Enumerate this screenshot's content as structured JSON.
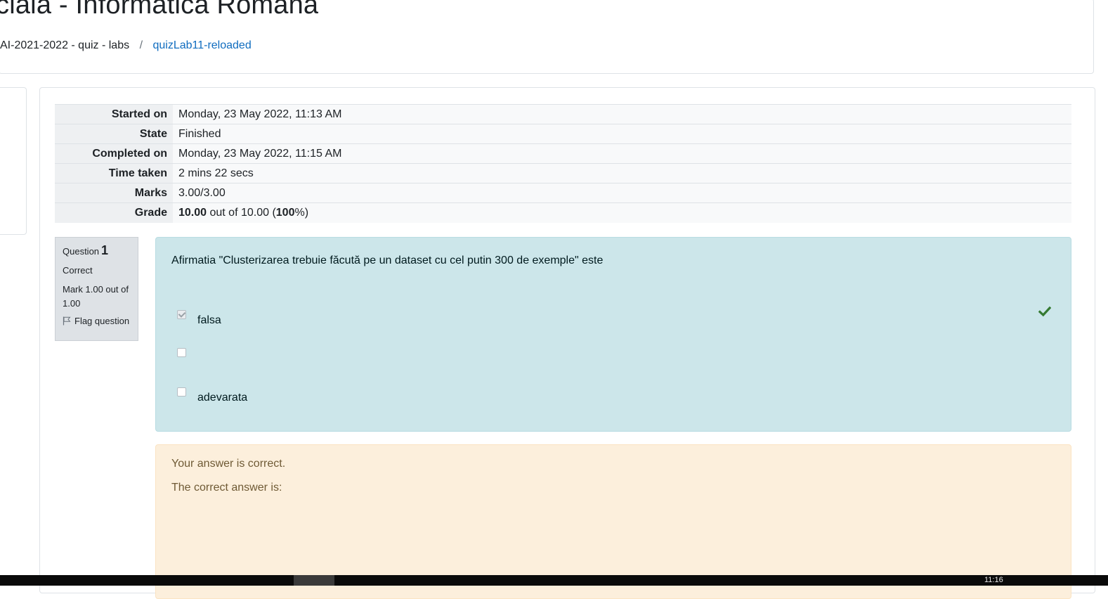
{
  "page": {
    "title": "ciala - Informatica Romana"
  },
  "breadcrumb": {
    "items": [
      "AI-2021-2022 - quiz - labs",
      "quizLab11-reloaded"
    ],
    "separator": "/"
  },
  "summary": {
    "rows": [
      {
        "label": "Started on",
        "value": "Monday, 23 May 2022, 11:13 AM"
      },
      {
        "label": "State",
        "value": "Finished"
      },
      {
        "label": "Completed on",
        "value": "Monday, 23 May 2022, 11:15 AM"
      },
      {
        "label": "Time taken",
        "value": "2 mins 22 secs"
      },
      {
        "label": "Marks",
        "value": "3.00/3.00"
      }
    ],
    "grade": {
      "label": "Grade",
      "score": "10.00",
      "out_of_text": " out of 10.00 (",
      "percent": "100",
      "suffix": "%)"
    }
  },
  "question": {
    "number_label": "Question",
    "number": "1",
    "state": "Correct",
    "mark": "Mark 1.00 out of 1.00",
    "flag_label": "Flag question",
    "text": "Afirmatia \"Clusterizarea trebuie făcută pe un dataset cu cel putin 300 de exemple\" este",
    "answers": [
      {
        "label": "falsa",
        "checked": true,
        "correct": true
      },
      {
        "label": "",
        "checked": false,
        "correct": false
      },
      {
        "label": "adevarata",
        "checked": false,
        "correct": false
      }
    ]
  },
  "feedback": {
    "line1": "Your answer is correct.",
    "line2": "The correct answer is:"
  },
  "taskbar": {
    "clock": "11:16"
  },
  "colors": {
    "link": "#0f6cbf",
    "formulation_bg": "#cce6ea",
    "feedback_bg": "#fcefdc",
    "correct_check": "#357a32"
  }
}
